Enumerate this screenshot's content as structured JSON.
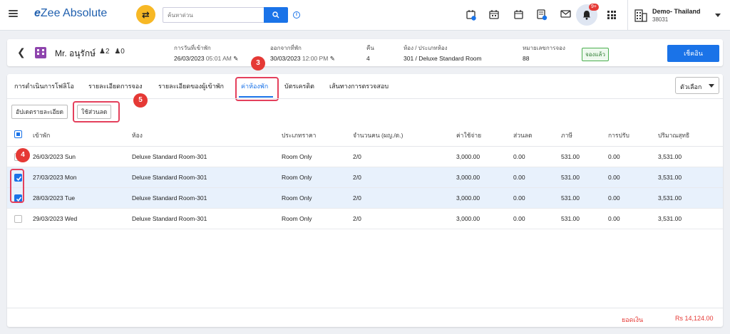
{
  "app": {
    "logo_prefix": "e",
    "logo_text": "Zee Absolute",
    "search_placeholder": "ค้นหาด่วน",
    "notification_count": "9+",
    "hotel_name": "Demo- Thailand",
    "hotel_id": "38031",
    "icons": [
      "menu-icon",
      "shuffle-icon",
      "search-icon",
      "info-icon",
      "calendar-add-icon",
      "calendar-grid-icon",
      "calendar-icon",
      "document-badge-icon",
      "mail-icon",
      "bell-icon",
      "apps-grid-icon",
      "hotel-building-icon"
    ]
  },
  "reservation": {
    "guest_name": "Mr. อนุรักษ์",
    "adults": "2",
    "children": "0",
    "arrival_label": "การวันที่เข้าพัก",
    "arrival_date": "26/03/2023",
    "arrival_time": "05:01 AM",
    "departure_label": "ออกจากที่พัก",
    "departure_date": "30/03/2023",
    "departure_time": "12:00 PM",
    "nights_label": "คืน",
    "nights": "4",
    "room_label": "ห้อง / ประเภทห้อง",
    "room": "301 / Deluxe Standard Room",
    "res_no_label": "หมายเลขการจอง",
    "res_no": "88",
    "status": "จองแล้ว",
    "checkout_button": "เช็คอิน"
  },
  "tabs": [
    {
      "label": "การดำเนินการโฟลิโอ"
    },
    {
      "label": "รายละเอียดการจอง"
    },
    {
      "label": "รายละเอียดของผู้เข้าพัก"
    },
    {
      "label": "ค่าห้องพัก"
    },
    {
      "label": "บัตรเครดิต"
    },
    {
      "label": "เส้นทางการตรวจสอบ"
    }
  ],
  "options_label": "ตัวเลือก",
  "actions": {
    "update_details": "อัปเดตรายละเอียด",
    "apply_discount": "ใช้ส่วนลด"
  },
  "annotations": {
    "step3": "3",
    "step4": "4",
    "step5": "5"
  },
  "table": {
    "headers": [
      "เข้าพัก",
      "ห้อง",
      "ประเภทราคา",
      "จำนวนคน (ผญ./ด.)",
      "ค่าใช้จ่าย",
      "ส่วนลด",
      "ภาษี",
      "การปรับ",
      "ปริมาณสุทธิ"
    ],
    "rows": [
      {
        "checked": false,
        "date": "26/03/2023 Sun",
        "room": "Deluxe Standard Room-301",
        "rate_type": "Room Only",
        "pax": "2/0",
        "charge": "3,000.00",
        "discount": "0.00",
        "tax": "531.00",
        "adjust": "0.00",
        "net": "3,531.00"
      },
      {
        "checked": true,
        "date": "27/03/2023 Mon",
        "room": "Deluxe Standard Room-301",
        "rate_type": "Room Only",
        "pax": "2/0",
        "charge": "3,000.00",
        "discount": "0.00",
        "tax": "531.00",
        "adjust": "0.00",
        "net": "3,531.00"
      },
      {
        "checked": true,
        "date": "28/03/2023 Tue",
        "room": "Deluxe Standard Room-301",
        "rate_type": "Room Only",
        "pax": "2/0",
        "charge": "3,000.00",
        "discount": "0.00",
        "tax": "531.00",
        "adjust": "0.00",
        "net": "3,531.00"
      },
      {
        "checked": false,
        "date": "29/03/2023 Wed",
        "room": "Deluxe Standard Room-301",
        "rate_type": "Room Only",
        "pax": "2/0",
        "charge": "3,000.00",
        "discount": "0.00",
        "tax": "531.00",
        "adjust": "0.00",
        "net": "3,531.00"
      }
    ]
  },
  "footer": {
    "balance_label": "ยอดเงิน",
    "balance_value": "Rs 14,124.00"
  },
  "colors": {
    "accent": "#1a73e8",
    "highlight": "#e4405c",
    "badge": "#e53935",
    "brand_yellow": "#f7b825"
  }
}
